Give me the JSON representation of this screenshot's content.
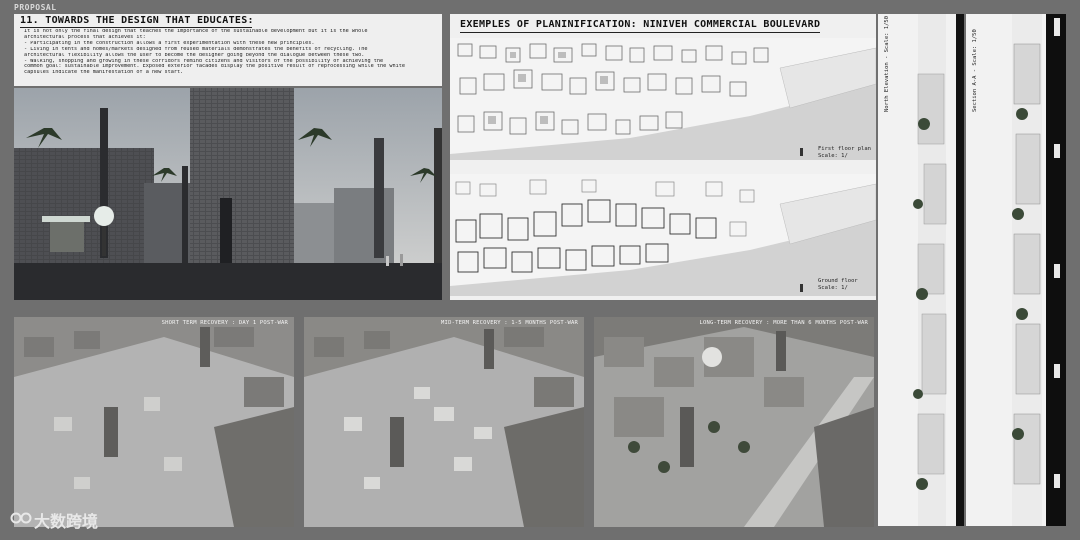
{
  "board": {
    "label": "PROPOSAL"
  },
  "intro": {
    "title": "11. TOWARDS THE DESIGN THAT EDUCATES:",
    "lines": [
      "It is not only the final design that teaches the importance of the sustainable development but it is the whole",
      "architectural process that achieves it:",
      "-   Participating in the construction allows a first experimentation with these new principles.",
      "-   Living in tents and homes/markets designed from reused materials demonstrates the benefits of recycling. The",
      "architectural flexibility allows the user to become the designer going beyond the dialogue between these two.",
      "-   Walking, shopping and growing in these corridors remind citizens and visitors of the possibility of achieving the",
      "common goal: sustainable improvement. Exposed exterior facades display the positive result of reprocessing while the white",
      "capsules indicate the manifestation of a new start."
    ]
  },
  "plans": {
    "title": "EXEMPLES OF PLANINIFICATION: NINIVEH COMMERCIAL BOULEVARD",
    "first_floor": {
      "name": "First floor plan",
      "scale": "Scale: 1/"
    },
    "ground_floor": {
      "name": "Ground floor",
      "scale": "Scale: 1/"
    }
  },
  "aerials": [
    {
      "stage": "SHORT TERM RECOVERY : DAY 1 POST-WAR"
    },
    {
      "stage": "MID-TERM RECOVERY : 1-5 MONTHS POST-WAR"
    },
    {
      "stage": "LONG-TERM RECOVERY : MORE THAN 6 MONTHS POST-WAR"
    }
  ],
  "elevations": [
    {
      "title": "North Elevation - Scale: 1/50"
    },
    {
      "title": "Section A-A - Scale: 1/50"
    }
  ],
  "watermark": {
    "text": "大数跨境"
  }
}
